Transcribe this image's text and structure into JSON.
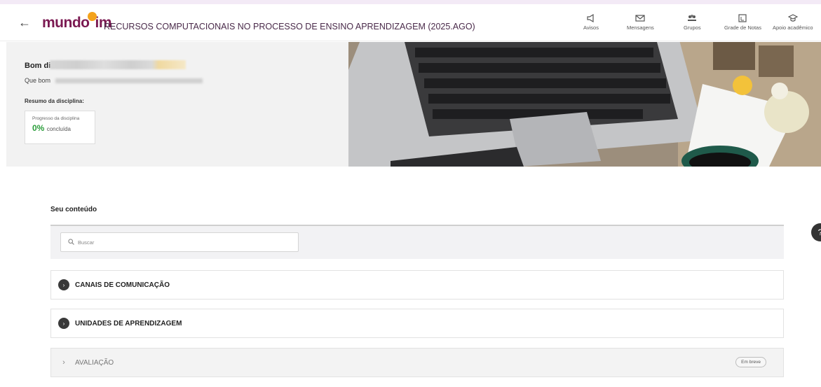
{
  "header": {
    "back_icon": "arrow-left-icon",
    "logo_text_1": "mundo",
    "logo_text_2": "im",
    "course_title": "RECURSOS COMPUTACIONAIS NO PROCESSO DE ENSINO APRENDIZAGEM (2025.AGO)",
    "nav": [
      {
        "label": "Avisos",
        "icon": "megaphone-icon"
      },
      {
        "label": "Mensagens",
        "icon": "envelope-icon"
      },
      {
        "label": "Grupos",
        "icon": "people-icon"
      },
      {
        "label": "Grade de Notas",
        "icon": "gradebook-icon"
      },
      {
        "label": "Apoio acadêmico",
        "icon": "graduation-cap-icon"
      }
    ]
  },
  "hero": {
    "greeting": "Bom dia",
    "subtitle": "Que bom",
    "summary_label": "Resumo da disciplina:",
    "progress_label": "Progresso da disciplina",
    "progress_value": "0%",
    "progress_suffix": "concluída",
    "progress_fraction": 0
  },
  "content": {
    "title": "Seu conteúdo",
    "search_placeholder": "Buscar",
    "sections": [
      {
        "label": "CANAIS DE COMUNICAÇÃO",
        "enabled": true
      },
      {
        "label": "UNIDADES DE APRENDIZAGEM",
        "enabled": true
      },
      {
        "label": "AVALIAÇÃO",
        "enabled": false,
        "badge": "Em breve"
      }
    ]
  },
  "colors": {
    "brand": "#7b1a52",
    "accent": "#f4a21b",
    "progress": "#2a9d3a"
  }
}
